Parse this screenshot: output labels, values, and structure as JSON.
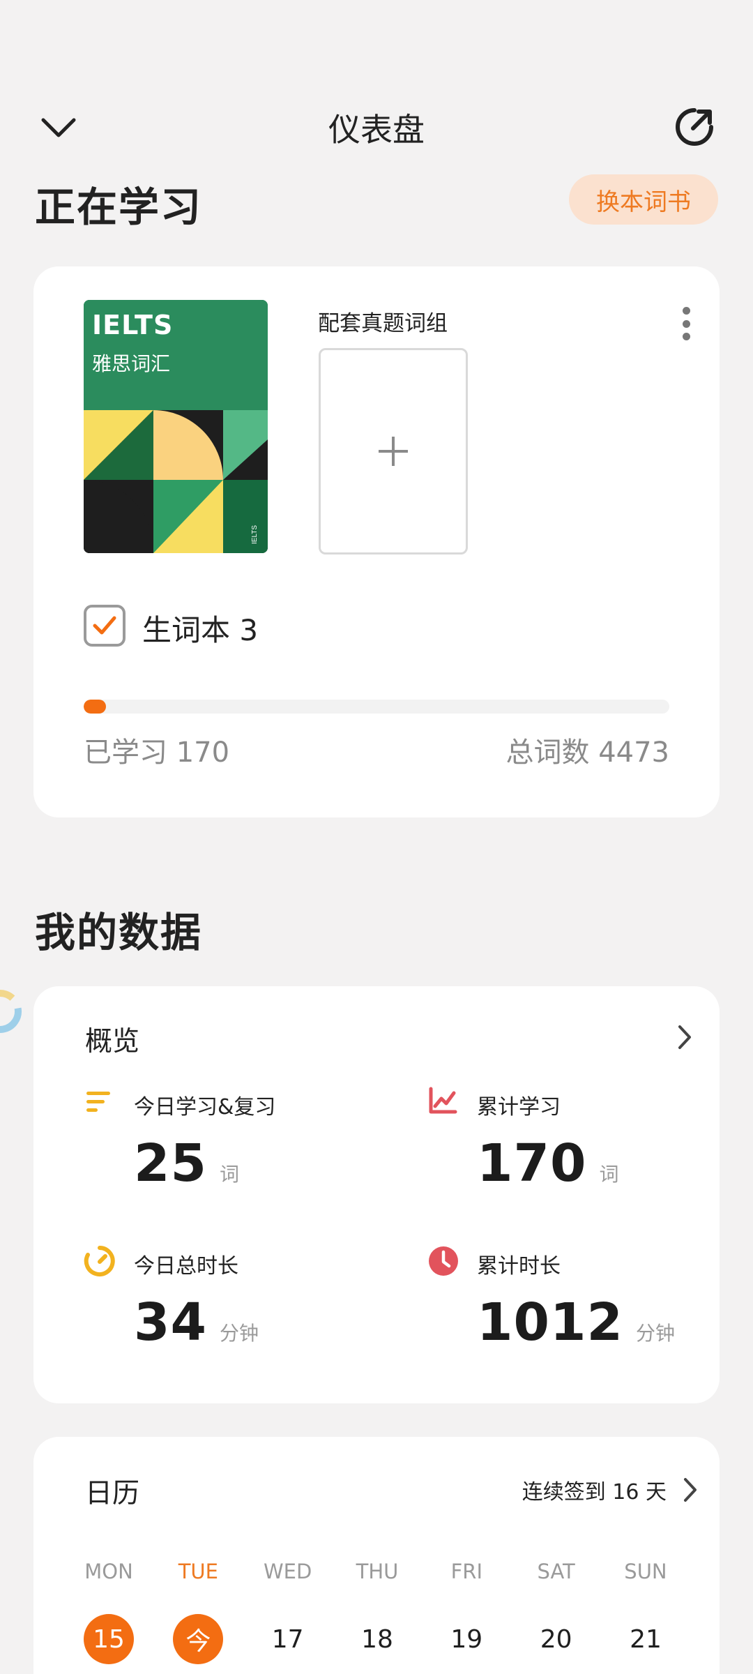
{
  "header": {
    "title": "仪表盘"
  },
  "studying": {
    "section_title": "正在学习",
    "switch_button": "换本词书",
    "book": {
      "cover_title": "IELTS",
      "cover_subtitle": "雅思词汇"
    },
    "pattern_label": "配套真题词组",
    "vocab_book_label": "生词本 3",
    "progress_fraction": 0.038,
    "learned": "已学习 170",
    "total": "总词数 4473"
  },
  "my_data": {
    "section_title": "我的数据",
    "overview": {
      "title": "概览",
      "stats": [
        {
          "label": "今日学习&复习",
          "value": "25",
          "unit": "词",
          "icon": "bars-icon",
          "color": "#f2b21f"
        },
        {
          "label": "累计学习",
          "value": "170",
          "unit": "词",
          "icon": "line-chart-icon",
          "color": "#e2535c"
        },
        {
          "label": "今日总时长",
          "value": "34",
          "unit": "分钟",
          "icon": "timer-icon",
          "color": "#f2b21f"
        },
        {
          "label": "累计时长",
          "value": "1012",
          "unit": "分钟",
          "icon": "clock-icon",
          "color": "#e2535c"
        }
      ]
    },
    "calendar": {
      "title": "日历",
      "streak": "连续签到 16 天",
      "weekdays": [
        "MON",
        "TUE",
        "WED",
        "THU",
        "FRI",
        "SAT",
        "SUN"
      ],
      "days": [
        "15",
        "今",
        "17",
        "18",
        "19",
        "20",
        "21"
      ]
    }
  },
  "colors": {
    "accent": "#f36d12",
    "accent_soft": "#fbe1cf",
    "background": "#f3f2f2"
  }
}
